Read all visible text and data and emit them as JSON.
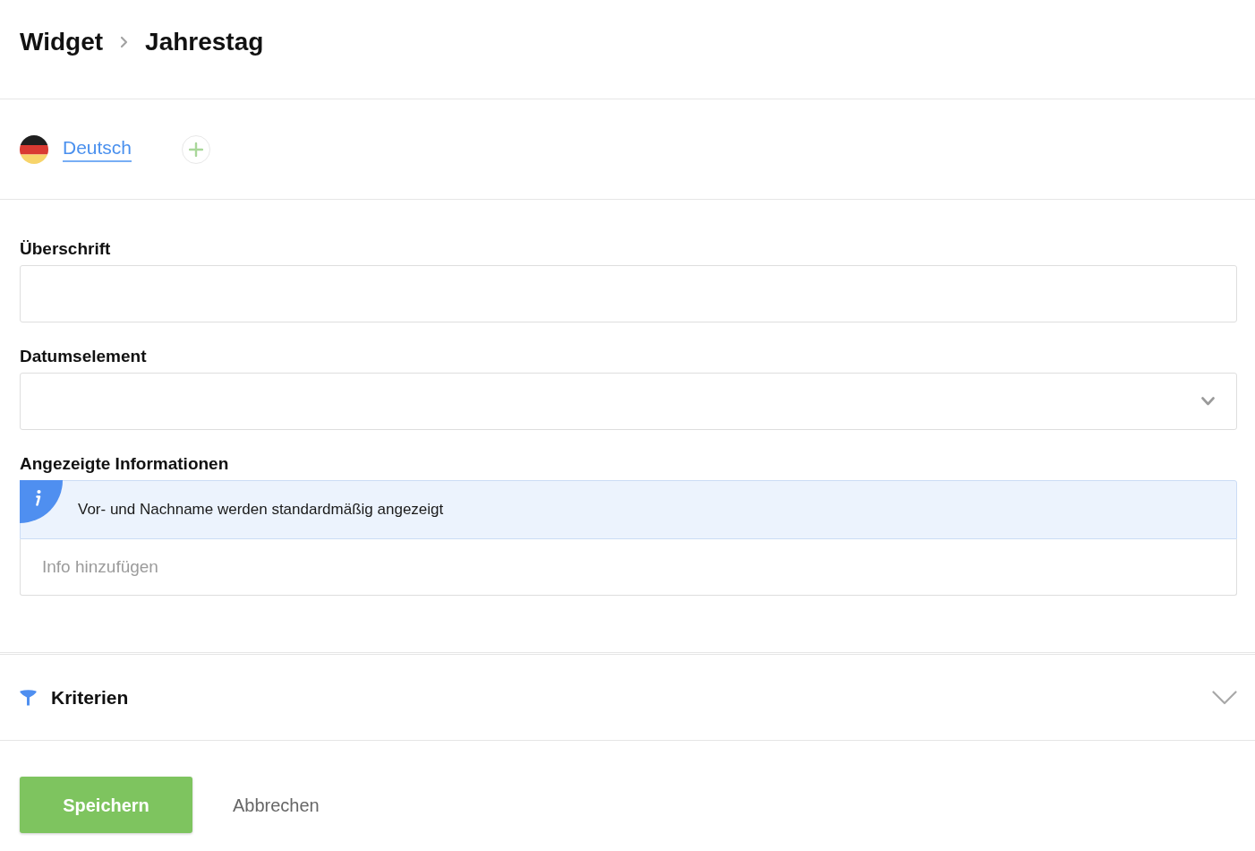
{
  "breadcrumb": [
    "Widget",
    "Jahrestag"
  ],
  "languages": [
    {
      "label": "Deutsch",
      "selected": true
    }
  ],
  "form": {
    "fields": [
      {
        "kind": "text",
        "label": "Überschrift"
      },
      {
        "kind": "select",
        "label": "Datumselement"
      },
      {
        "kind": "info",
        "label": "Angezeigte Informationen",
        "notice": "Vor- und Nachname werden standardmäßig angezeigt",
        "placeholder": "Info hinzufügen"
      }
    ]
  },
  "criteria": {
    "title": "Kriterien",
    "expanded": false
  },
  "buttons": [
    {
      "label": "Speichern",
      "kind": "primary"
    },
    {
      "label": "Abbrechen",
      "kind": "secondary"
    }
  ]
}
